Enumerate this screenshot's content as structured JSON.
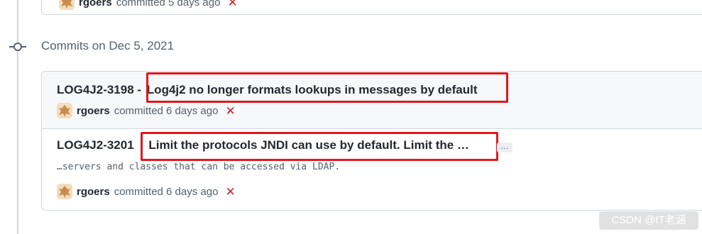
{
  "top_commit": {
    "author": "rgoers",
    "meta": "committed 5 days ago"
  },
  "group": {
    "title": "Commits on Dec 5, 2021"
  },
  "commits": [
    {
      "id_prefix": "LOG4J2-3198 -",
      "message": "Log4j2 no longer formats lookups in messages by default",
      "author": "rgoers",
      "meta": "committed 6 days ago"
    },
    {
      "id_prefix": "LOG4J2-3201",
      "message": "Limit the protocols JNDI can use by default. Limit the …",
      "ellipsis_label": "…",
      "description": "…servers and classes that can be accessed via LDAP.",
      "author": "rgoers",
      "meta": "committed 6 days ago"
    }
  ],
  "watermark": "CSDN @IT老涵",
  "colors": {
    "highlight_box": "#e0171b",
    "status_fail": "#cf222e"
  },
  "icons": {
    "commit_node": "git-commit-icon",
    "status": "x-icon"
  }
}
